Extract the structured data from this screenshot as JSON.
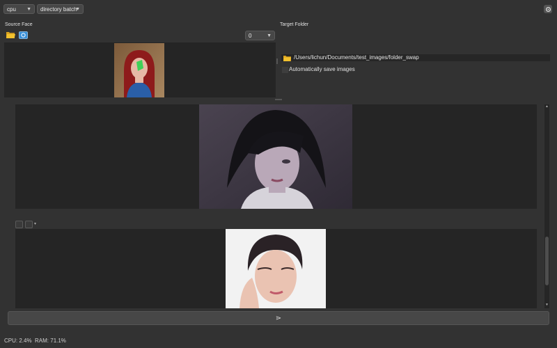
{
  "toolbar": {
    "device": "cpu",
    "mode": "directory batch"
  },
  "source": {
    "label": "Source Face",
    "index_value": "0"
  },
  "target": {
    "label": "Target Folder",
    "path": "/Users/lichun/Documents/test_images/folder_swap",
    "autosave_label": "Automatically save images",
    "autosave_checked": false
  },
  "run": {
    "icon": "play-arrow-icon",
    "symbol": "⋗"
  },
  "status": {
    "text": "CPU: 2.4%  RAM: 71.1%"
  },
  "icons": {
    "settings": "gear-icon",
    "open_folder": "folder-open-icon",
    "camera": "camera-icon",
    "target_folder": "folder-icon"
  },
  "colors": {
    "background": "#323232",
    "panel": "#252525",
    "folder": "#f2c12e",
    "camera": "#3a8fd6",
    "face_marker": "#22d34a"
  }
}
